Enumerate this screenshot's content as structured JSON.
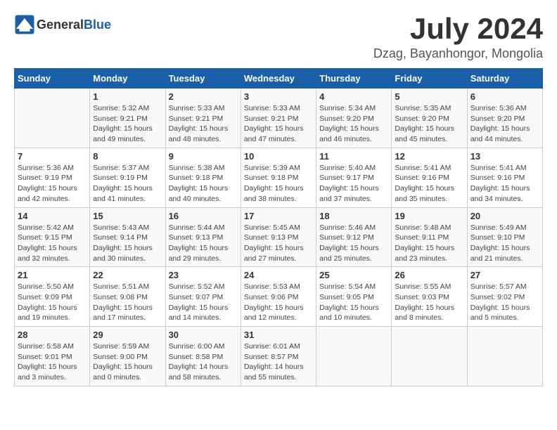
{
  "header": {
    "logo_general": "General",
    "logo_blue": "Blue",
    "month_year": "July 2024",
    "location": "Dzag, Bayanhongor, Mongolia"
  },
  "weekdays": [
    "Sunday",
    "Monday",
    "Tuesday",
    "Wednesday",
    "Thursday",
    "Friday",
    "Saturday"
  ],
  "weeks": [
    [
      {
        "day": "",
        "info": ""
      },
      {
        "day": "1",
        "info": "Sunrise: 5:32 AM\nSunset: 9:21 PM\nDaylight: 15 hours\nand 49 minutes."
      },
      {
        "day": "2",
        "info": "Sunrise: 5:33 AM\nSunset: 9:21 PM\nDaylight: 15 hours\nand 48 minutes."
      },
      {
        "day": "3",
        "info": "Sunrise: 5:33 AM\nSunset: 9:21 PM\nDaylight: 15 hours\nand 47 minutes."
      },
      {
        "day": "4",
        "info": "Sunrise: 5:34 AM\nSunset: 9:20 PM\nDaylight: 15 hours\nand 46 minutes."
      },
      {
        "day": "5",
        "info": "Sunrise: 5:35 AM\nSunset: 9:20 PM\nDaylight: 15 hours\nand 45 minutes."
      },
      {
        "day": "6",
        "info": "Sunrise: 5:36 AM\nSunset: 9:20 PM\nDaylight: 15 hours\nand 44 minutes."
      }
    ],
    [
      {
        "day": "7",
        "info": "Sunrise: 5:36 AM\nSunset: 9:19 PM\nDaylight: 15 hours\nand 42 minutes."
      },
      {
        "day": "8",
        "info": "Sunrise: 5:37 AM\nSunset: 9:19 PM\nDaylight: 15 hours\nand 41 minutes."
      },
      {
        "day": "9",
        "info": "Sunrise: 5:38 AM\nSunset: 9:18 PM\nDaylight: 15 hours\nand 40 minutes."
      },
      {
        "day": "10",
        "info": "Sunrise: 5:39 AM\nSunset: 9:18 PM\nDaylight: 15 hours\nand 38 minutes."
      },
      {
        "day": "11",
        "info": "Sunrise: 5:40 AM\nSunset: 9:17 PM\nDaylight: 15 hours\nand 37 minutes."
      },
      {
        "day": "12",
        "info": "Sunrise: 5:41 AM\nSunset: 9:16 PM\nDaylight: 15 hours\nand 35 minutes."
      },
      {
        "day": "13",
        "info": "Sunrise: 5:41 AM\nSunset: 9:16 PM\nDaylight: 15 hours\nand 34 minutes."
      }
    ],
    [
      {
        "day": "14",
        "info": "Sunrise: 5:42 AM\nSunset: 9:15 PM\nDaylight: 15 hours\nand 32 minutes."
      },
      {
        "day": "15",
        "info": "Sunrise: 5:43 AM\nSunset: 9:14 PM\nDaylight: 15 hours\nand 30 minutes."
      },
      {
        "day": "16",
        "info": "Sunrise: 5:44 AM\nSunset: 9:13 PM\nDaylight: 15 hours\nand 29 minutes."
      },
      {
        "day": "17",
        "info": "Sunrise: 5:45 AM\nSunset: 9:13 PM\nDaylight: 15 hours\nand 27 minutes."
      },
      {
        "day": "18",
        "info": "Sunrise: 5:46 AM\nSunset: 9:12 PM\nDaylight: 15 hours\nand 25 minutes."
      },
      {
        "day": "19",
        "info": "Sunrise: 5:48 AM\nSunset: 9:11 PM\nDaylight: 15 hours\nand 23 minutes."
      },
      {
        "day": "20",
        "info": "Sunrise: 5:49 AM\nSunset: 9:10 PM\nDaylight: 15 hours\nand 21 minutes."
      }
    ],
    [
      {
        "day": "21",
        "info": "Sunrise: 5:50 AM\nSunset: 9:09 PM\nDaylight: 15 hours\nand 19 minutes."
      },
      {
        "day": "22",
        "info": "Sunrise: 5:51 AM\nSunset: 9:08 PM\nDaylight: 15 hours\nand 17 minutes."
      },
      {
        "day": "23",
        "info": "Sunrise: 5:52 AM\nSunset: 9:07 PM\nDaylight: 15 hours\nand 14 minutes."
      },
      {
        "day": "24",
        "info": "Sunrise: 5:53 AM\nSunset: 9:06 PM\nDaylight: 15 hours\nand 12 minutes."
      },
      {
        "day": "25",
        "info": "Sunrise: 5:54 AM\nSunset: 9:05 PM\nDaylight: 15 hours\nand 10 minutes."
      },
      {
        "day": "26",
        "info": "Sunrise: 5:55 AM\nSunset: 9:03 PM\nDaylight: 15 hours\nand 8 minutes."
      },
      {
        "day": "27",
        "info": "Sunrise: 5:57 AM\nSunset: 9:02 PM\nDaylight: 15 hours\nand 5 minutes."
      }
    ],
    [
      {
        "day": "28",
        "info": "Sunrise: 5:58 AM\nSunset: 9:01 PM\nDaylight: 15 hours\nand 3 minutes."
      },
      {
        "day": "29",
        "info": "Sunrise: 5:59 AM\nSunset: 9:00 PM\nDaylight: 15 hours\nand 0 minutes."
      },
      {
        "day": "30",
        "info": "Sunrise: 6:00 AM\nSunset: 8:58 PM\nDaylight: 14 hours\nand 58 minutes."
      },
      {
        "day": "31",
        "info": "Sunrise: 6:01 AM\nSunset: 8:57 PM\nDaylight: 14 hours\nand 55 minutes."
      },
      {
        "day": "",
        "info": ""
      },
      {
        "day": "",
        "info": ""
      },
      {
        "day": "",
        "info": ""
      }
    ]
  ]
}
